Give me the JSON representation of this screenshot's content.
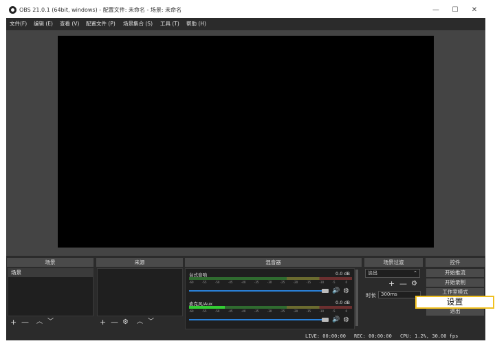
{
  "window": {
    "title": "OBS 21.0.1 (64bit, windows) - 配置文件: 未命名 - 场景: 未命名",
    "minimize_label": "—",
    "maximize_label": "☐",
    "close_label": "✕"
  },
  "menu": {
    "items": [
      "文件(F)",
      "编辑 (E)",
      "查看 (V)",
      "配置文件 (P)",
      "场景集合 (S)",
      "工具 (T)",
      "帮助 (H)"
    ]
  },
  "docks": {
    "scenes": {
      "title": "场景",
      "items": [
        "场景"
      ]
    },
    "sources": {
      "title": "来源"
    },
    "mixer": {
      "title": "混音器",
      "channels": [
        {
          "name": "台式音响",
          "db": "0.0 dB",
          "level": 0.0
        },
        {
          "name": "麦克风/Aux",
          "db": "0.0 dB",
          "level": 0.22
        }
      ],
      "tick_labels": [
        "-60",
        "-55",
        "-50",
        "-45",
        "-40",
        "-35",
        "-30",
        "-25",
        "-20",
        "-15",
        "-10",
        "-5",
        "0"
      ]
    },
    "transitions": {
      "title": "场景过渡",
      "selected": "淡出",
      "duration_label": "时长",
      "duration_value": "300ms"
    },
    "controls": {
      "title": "控件",
      "buttons": [
        "开始推流",
        "开始录制",
        "工作室模式",
        "设置",
        "退出"
      ]
    }
  },
  "icons": {
    "add": "+",
    "remove": "—",
    "up": "︿",
    "down": "﹀",
    "gear": "⚙",
    "speaker": "🔊",
    "spin": "⌃"
  },
  "status": {
    "live": "LIVE: 00:00:00",
    "rec": "REC: 00:00:00",
    "cpu": "CPU: 1.2%, 30.00 fps"
  },
  "tooltip": {
    "text": "设置"
  },
  "colors": {
    "accent": "#2a82da",
    "highlight_border": "#f0c020"
  }
}
